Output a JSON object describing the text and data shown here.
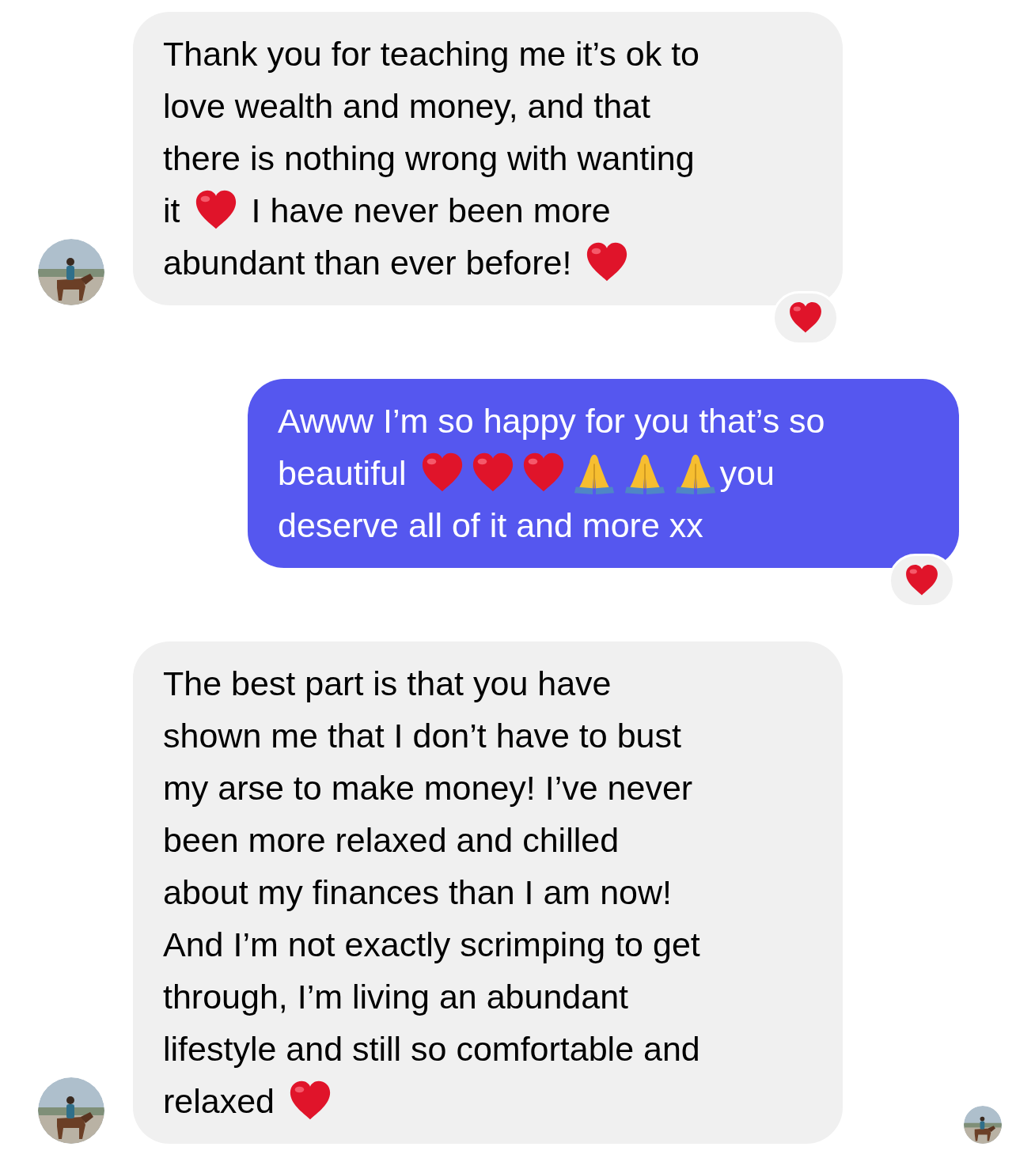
{
  "messages": [
    {
      "kind": "incoming",
      "avatar": true,
      "reacted": true,
      "lines": [
        [
          {
            "kind": "text",
            "text": "Thank you for teaching me it’s ok to"
          }
        ],
        [
          {
            "kind": "text",
            "text": "love wealth and money, and that"
          }
        ],
        [
          {
            "kind": "text",
            "text": "there is nothing wrong with wanting"
          }
        ],
        [
          {
            "kind": "text",
            "text": "it"
          },
          {
            "kind": "heart"
          },
          {
            "kind": "text",
            "text": "I have never been more"
          }
        ],
        [
          {
            "kind": "text",
            "text": "abundant than ever before!"
          },
          {
            "kind": "heart"
          }
        ]
      ]
    },
    {
      "kind": "outgoing",
      "avatar": false,
      "reacted": true,
      "lines": [
        [
          {
            "kind": "text",
            "text": "Awww I’m so happy for you that’s so"
          }
        ],
        [
          {
            "kind": "text",
            "text": "beautiful"
          },
          {
            "kind": "heart"
          },
          {
            "kind": "heart"
          },
          {
            "kind": "heart"
          },
          {
            "kind": "hands"
          },
          {
            "kind": "hands"
          },
          {
            "kind": "hands"
          },
          {
            "kind": "text",
            "text": "you"
          }
        ],
        [
          {
            "kind": "text",
            "text": "deserve all of it and more xx"
          }
        ]
      ]
    },
    {
      "kind": "incoming",
      "avatar": true,
      "reacted": false,
      "lines": [
        [
          {
            "kind": "text",
            "text": "The best part is that you have"
          }
        ],
        [
          {
            "kind": "text",
            "text": "shown me that I don’t have to bust"
          }
        ],
        [
          {
            "kind": "text",
            "text": "my arse to make money! I’ve never"
          }
        ],
        [
          {
            "kind": "text",
            "text": "been more relaxed and chilled"
          }
        ],
        [
          {
            "kind": "text",
            "text": "about my finances than I am now!"
          }
        ],
        [
          {
            "kind": "text",
            "text": "And I’m not exactly scrimping to get"
          }
        ],
        [
          {
            "kind": "text",
            "text": "through, I’m living an abundant"
          }
        ],
        [
          {
            "kind": "text",
            "text": "lifestyle and still so comfortable and"
          }
        ],
        [
          {
            "kind": "text",
            "text": "relaxed"
          },
          {
            "kind": "heart"
          }
        ]
      ]
    }
  ],
  "read_receipt": true
}
